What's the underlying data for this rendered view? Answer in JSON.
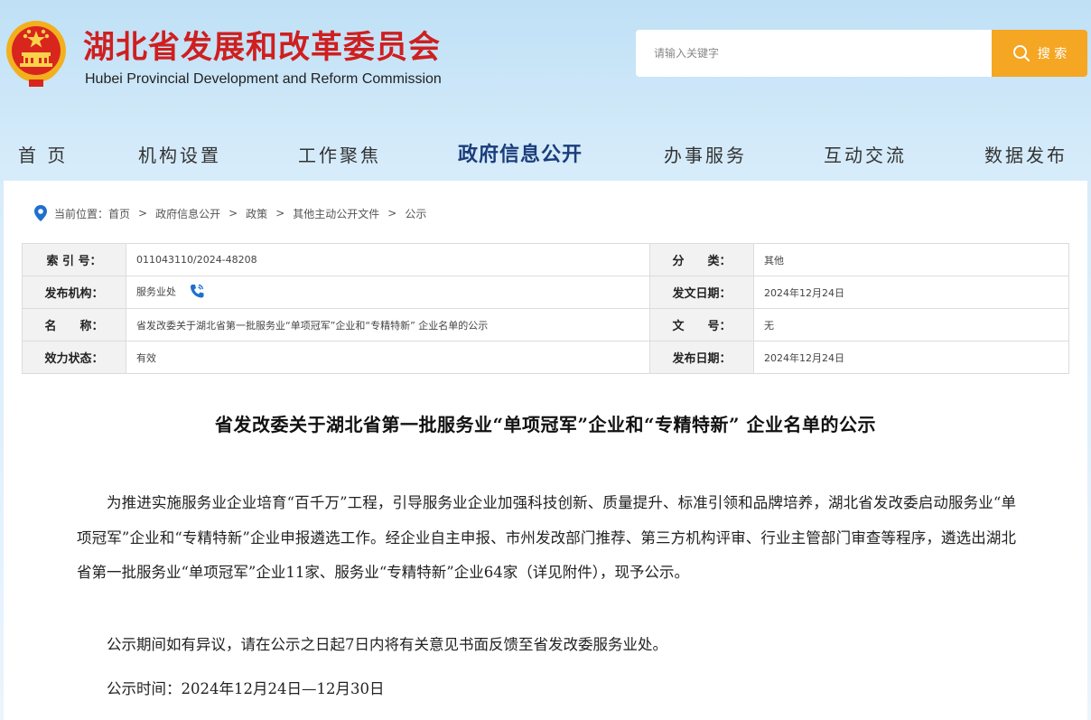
{
  "header": {
    "site_title": "湖北省发展和改革委员会",
    "site_subtitle": "Hubei Provincial Development and Reform Commission",
    "search_placeholder": "请输入关键字",
    "search_button": "搜 索"
  },
  "nav": {
    "items": [
      "首 页",
      "机构设置",
      "工作聚焦",
      "政府信息公开",
      "办事服务",
      "互动交流",
      "数据发布"
    ],
    "active_index": 3
  },
  "breadcrumb": {
    "prefix": "当前位置：",
    "items": [
      "首页",
      "政府信息公开",
      "政策",
      "其他主动公开文件",
      "公示"
    ],
    "separator": ">"
  },
  "meta": {
    "index_label": "索 引 号：",
    "index_value": "011043110/2024-48208",
    "category_label": "分　　类：",
    "category_value": "其他",
    "issuer_label": "发布机构：",
    "issuer_value": "服务业处",
    "issue_date_label": "发文日期：",
    "issue_date_value": "2024年12月24日",
    "name_label": "名　　称：",
    "name_value": "省发改委关于湖北省第一批服务业“单项冠军”企业和“专精特新” 企业名单的公示",
    "doc_no_label": "文　　号：",
    "doc_no_value": "无",
    "status_label": "效力状态：",
    "status_value": "有效",
    "publish_date_label": "发布日期：",
    "publish_date_value": "2024年12月24日"
  },
  "document": {
    "title": "省发改委关于湖北省第一批服务业“单项冠军”企业和“专精特新”  企业名单的公示",
    "paragraphs": [
      "为推进实施服务业企业培育“百千万”工程，引导服务业企业加强科技创新、质量提升、标准引领和品牌培养，湖北省发改委启动服务业“单项冠军”企业和“专精特新”企业申报遴选工作。经企业自主申报、市州发改部门推荐、第三方机构评审、行业主管部门审查等程序，遴选出湖北省第一批服务业“单项冠军”企业11家、服务业“专精特新”企业64家（详见附件），现予公示。",
      "公示期间如有异议，请在公示之日起7日内将有关意见书面反馈至省发改委服务业处。",
      "公示时间：2024年12月24日—12月30日"
    ]
  },
  "colors": {
    "title_red": "#cf1f1f",
    "search_orange": "#f5a623",
    "nav_active": "#1b3d7a",
    "location_blue": "#1e6fd0"
  }
}
